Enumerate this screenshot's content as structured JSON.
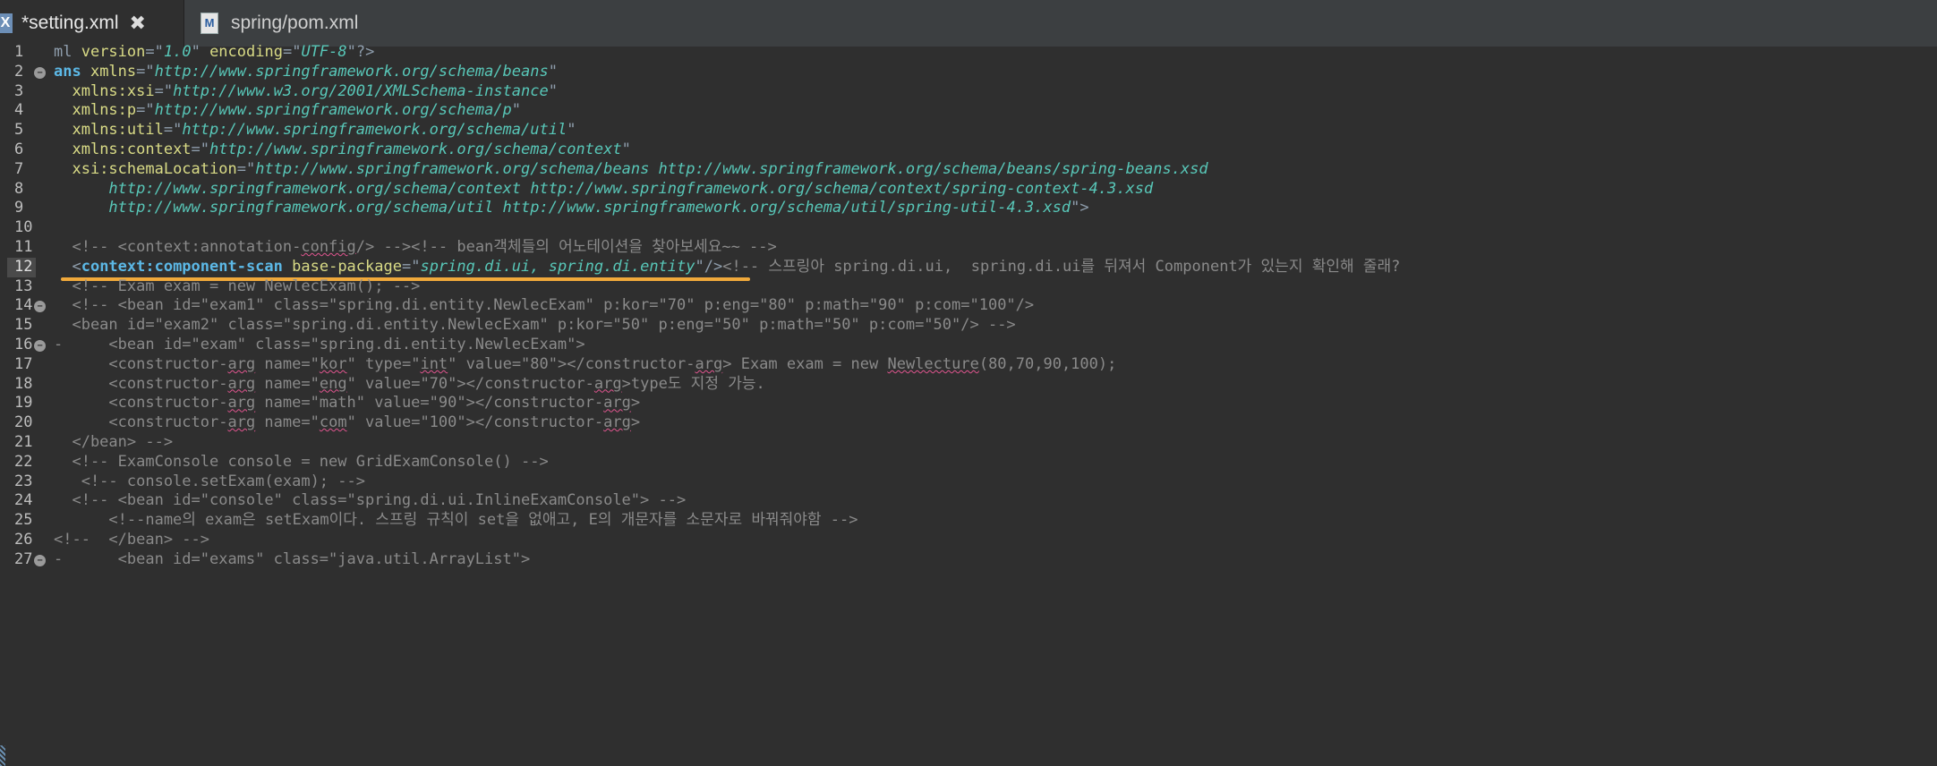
{
  "tabs": [
    {
      "label": "*setting.xml",
      "active": true,
      "icon": "xml-file-icon"
    },
    {
      "label": "spring/pom.xml",
      "active": false,
      "icon": "maven-pom-icon"
    }
  ],
  "editor": {
    "current_line": 12,
    "lines": [
      {
        "n": "1",
        "segs": [
          [
            "punct",
            "ml "
          ],
          [
            "attr",
            "version"
          ],
          [
            "punct",
            "=\""
          ],
          [
            "val",
            "1.0"
          ],
          [
            "punct",
            "\" "
          ],
          [
            "attr",
            "encoding"
          ],
          [
            "punct",
            "=\""
          ],
          [
            "val",
            "UTF-8"
          ],
          [
            "punct",
            "\"?>"
          ]
        ]
      },
      {
        "n": "2",
        "fold": true,
        "segs": [
          [
            "tag",
            "ans "
          ],
          [
            "attr",
            "xmlns"
          ],
          [
            "punct",
            "=\""
          ],
          [
            "val",
            "http://www.springframework.org/schema/beans"
          ],
          [
            "punct",
            "\""
          ]
        ]
      },
      {
        "n": "3",
        "segs": [
          [
            "plain",
            "  "
          ],
          [
            "attr",
            "xmlns:xsi"
          ],
          [
            "punct",
            "=\""
          ],
          [
            "val",
            "http://www.w3.org/2001/XMLSchema-instance"
          ],
          [
            "punct",
            "\""
          ]
        ]
      },
      {
        "n": "4",
        "segs": [
          [
            "plain",
            "  "
          ],
          [
            "attr",
            "xmlns:p"
          ],
          [
            "punct",
            "=\""
          ],
          [
            "val",
            "http://www.springframework.org/schema/p"
          ],
          [
            "punct",
            "\""
          ]
        ]
      },
      {
        "n": "5",
        "segs": [
          [
            "plain",
            "  "
          ],
          [
            "attr",
            "xmlns:util"
          ],
          [
            "punct",
            "=\""
          ],
          [
            "val",
            "http://www.springframework.org/schema/util"
          ],
          [
            "punct",
            "\""
          ]
        ]
      },
      {
        "n": "6",
        "segs": [
          [
            "plain",
            "  "
          ],
          [
            "attr",
            "xmlns:context"
          ],
          [
            "punct",
            "=\""
          ],
          [
            "val",
            "http://www.springframework.org/schema/context"
          ],
          [
            "punct",
            "\""
          ]
        ]
      },
      {
        "n": "7",
        "segs": [
          [
            "plain",
            "  "
          ],
          [
            "attr",
            "xsi:schemaLocation"
          ],
          [
            "punct",
            "=\""
          ],
          [
            "val",
            "http://www.springframework.org/schema/beans http://www.springframework.org/schema/beans/spring-beans.xsd"
          ]
        ]
      },
      {
        "n": "8",
        "segs": [
          [
            "plain",
            "      "
          ],
          [
            "val",
            "http://www.springframework.org/schema/context http://www.springframework.org/schema/context/spring-context-4.3.xsd"
          ]
        ]
      },
      {
        "n": "9",
        "segs": [
          [
            "plain",
            "      "
          ],
          [
            "val",
            "http://www.springframework.org/schema/util http://www.springframework.org/schema/util/spring-util-4.3.xsd"
          ],
          [
            "punct",
            "\">"
          ]
        ]
      },
      {
        "n": "10",
        "segs": []
      },
      {
        "n": "11",
        "segs": [
          [
            "comment",
            "  <!-- <context:annotation-"
          ],
          [
            "commentsq",
            "config"
          ],
          [
            "comment",
            "/> --><!-- bean객체들의 어노테이션을 찾아보세요~~ -->"
          ]
        ]
      },
      {
        "n": "12",
        "segs": [
          [
            "punct",
            "  <"
          ],
          [
            "tag",
            "context:component-scan"
          ],
          [
            "plain",
            " "
          ],
          [
            "attr",
            "base-package"
          ],
          [
            "punct",
            "=\""
          ],
          [
            "val",
            "spring.di.ui, spring.di.entity"
          ],
          [
            "punct",
            "\"/>"
          ],
          [
            "comment",
            "<!-- 스프링아 spring.di.ui,  spring.di.ui를 뒤져서 Component가 있는지 확인해 줄래?"
          ]
        ]
      },
      {
        "n": "13",
        "segs": [
          [
            "comment",
            "  <!-- Exam exam = new NewlecExam(); -->"
          ]
        ]
      },
      {
        "n": "14",
        "fold": true,
        "segs": [
          [
            "comment",
            "  <!-- <bean id=\"exam1\" class=\"spring.di.entity.NewlecExam\" p:kor=\"70\" p:eng=\"80\" p:math=\"90\" p:com=\"100\"/>"
          ]
        ]
      },
      {
        "n": "15",
        "segs": [
          [
            "comment",
            "  <bean id=\"exam2\" class=\"spring.di.entity.NewlecExam\" p:kor=\"50\" p:eng=\"50\" p:math=\"50\" p:com=\"50\"/> -->"
          ]
        ]
      },
      {
        "n": "16",
        "fold": true,
        "segs": [
          [
            "comment",
            "-     <bean id=\"exam\" class=\"spring.di.entity.NewlecExam\">"
          ]
        ]
      },
      {
        "n": "17",
        "segs": [
          [
            "comment",
            "      <constructor-"
          ],
          [
            "commentsq",
            "arg"
          ],
          [
            "comment",
            " name=\""
          ],
          [
            "commentsq",
            "kor"
          ],
          [
            "comment",
            "\" type=\""
          ],
          [
            "commentsq",
            "int"
          ],
          [
            "comment",
            "\" value=\"80\"></constructor-"
          ],
          [
            "commentsq",
            "arg"
          ],
          [
            "comment",
            "> Exam exam = new "
          ],
          [
            "commentsq",
            "Newlecture"
          ],
          [
            "comment",
            "(80,70,90,100);"
          ]
        ]
      },
      {
        "n": "18",
        "segs": [
          [
            "comment",
            "      <constructor-"
          ],
          [
            "commentsq",
            "arg"
          ],
          [
            "comment",
            " name=\""
          ],
          [
            "commentsq",
            "eng"
          ],
          [
            "comment",
            "\" value=\"70\"></constructor-"
          ],
          [
            "commentsq",
            "arg"
          ],
          [
            "comment",
            ">type도 지정 가능."
          ]
        ]
      },
      {
        "n": "19",
        "segs": [
          [
            "comment",
            "      <constructor-"
          ],
          [
            "commentsq",
            "arg"
          ],
          [
            "comment",
            " name=\"math\" value=\"90\"></constructor-"
          ],
          [
            "commentsq",
            "arg"
          ],
          [
            "comment",
            ">"
          ]
        ]
      },
      {
        "n": "20",
        "segs": [
          [
            "comment",
            "      <constructor-"
          ],
          [
            "commentsq",
            "arg"
          ],
          [
            "comment",
            " name=\""
          ],
          [
            "commentsq",
            "com"
          ],
          [
            "comment",
            "\" value=\"100\"></constructor-"
          ],
          [
            "commentsq",
            "arg"
          ],
          [
            "comment",
            ">"
          ]
        ]
      },
      {
        "n": "21",
        "segs": [
          [
            "comment",
            "  </bean> -->"
          ]
        ]
      },
      {
        "n": "22",
        "segs": [
          [
            "comment",
            "  <!-- ExamConsole console = new GridExamConsole() -->"
          ]
        ]
      },
      {
        "n": "23",
        "segs": [
          [
            "comment",
            "   <!-- console.setExam(exam); -->"
          ]
        ]
      },
      {
        "n": "24",
        "segs": [
          [
            "comment",
            "  <!-- <bean id=\"console\" class=\"spring.di.ui.InlineExamConsole\"> -->"
          ]
        ]
      },
      {
        "n": "25",
        "segs": [
          [
            "comment",
            "      <!--name의 exam은 setExam이다. 스프링 규칙이 set을 없애고, E의 개문자를 소문자로 바꿔줘야함 -->"
          ]
        ]
      },
      {
        "n": "26",
        "segs": [
          [
            "comment",
            "<!--  </bean> -->"
          ]
        ]
      },
      {
        "n": "27",
        "fold": true,
        "segs": [
          [
            "comment",
            "-      <bean id=\"exams\" class=\"java.util.ArrayList\">"
          ]
        ]
      }
    ]
  }
}
